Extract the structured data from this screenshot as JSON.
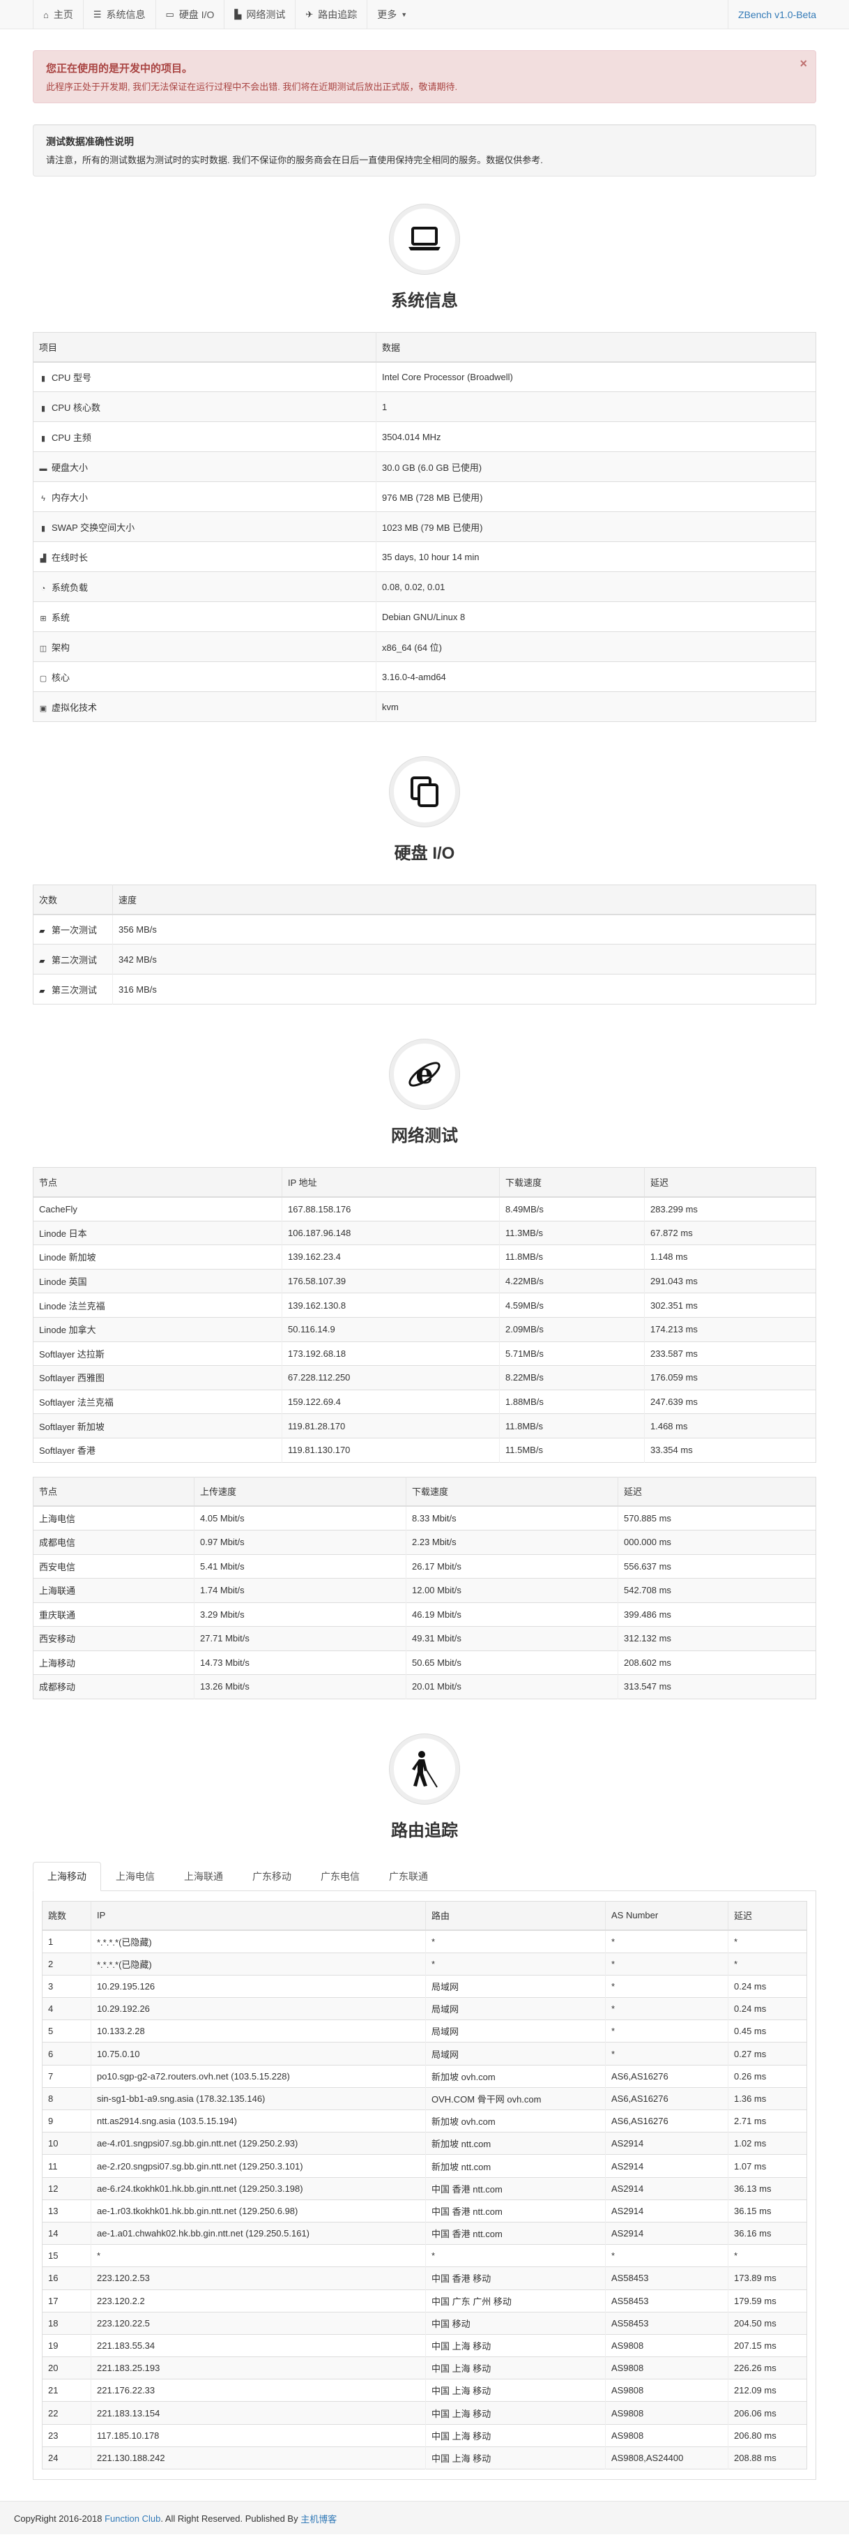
{
  "nav": {
    "items": [
      {
        "icon": "home-icon",
        "glyph": "⌂",
        "label": "主页"
      },
      {
        "icon": "list-icon",
        "glyph": "☰",
        "label": "系统信息"
      },
      {
        "icon": "monitor-icon",
        "glyph": "▭",
        "label": "硬盘 I/O"
      },
      {
        "icon": "stats-icon",
        "glyph": "▙",
        "label": "网络测试"
      },
      {
        "icon": "plane-icon",
        "glyph": "✈",
        "label": "路由追踪"
      }
    ],
    "more_label": "更多",
    "brand": "ZBench v1.0-Beta"
  },
  "alert": {
    "title": "您正在使用的是开发中的项目。",
    "body": "此程序正处于开发期, 我们无法保证在运行过程中不会出错. 我们将在近期测试后放出正式版，敬请期待.",
    "close": "×"
  },
  "notice": {
    "title": "测试数据准确性说明",
    "body": "请注意，所有的测试数据为测试时的实时数据. 我们不保证你的服务商会在日后一直使用保持完全相同的服务。数据仅供参考."
  },
  "sysinfo": {
    "title": "系统信息",
    "headers": [
      "项目",
      "数据"
    ],
    "rows": [
      {
        "icon": "cpu-icon",
        "glyph": "▮",
        "label": "CPU 型号",
        "value": "Intel Core Processor (Broadwell)"
      },
      {
        "icon": "cpu-icon",
        "glyph": "▮",
        "label": "CPU 核心数",
        "value": "1"
      },
      {
        "icon": "cpu-icon",
        "glyph": "▮",
        "label": "CPU 主频",
        "value": "3504.014 MHz"
      },
      {
        "icon": "hdd-icon",
        "glyph": "▬",
        "label": "硬盘大小",
        "value": "30.0 GB (6.0 GB 已使用)"
      },
      {
        "icon": "flash-icon",
        "glyph": "ϟ",
        "label": "内存大小",
        "value": "976 MB (728 MB 已使用)"
      },
      {
        "icon": "cpu-icon",
        "glyph": "▮",
        "label": "SWAP 交换空间大小",
        "value": "1023 MB (79 MB 已使用)"
      },
      {
        "icon": "chart-icon",
        "glyph": "▟",
        "label": "在线时长",
        "value": "35 days, 10 hour 14 min"
      },
      {
        "icon": "pie-icon",
        "glyph": "◔",
        "label": "系统负载",
        "value": "0.08, 0.02, 0.01"
      },
      {
        "icon": "windows-icon",
        "glyph": "⊞",
        "label": "系统",
        "value": "Debian GNU/Linux 8"
      },
      {
        "icon": "layout-icon",
        "glyph": "◫",
        "label": "架构",
        "value": "x86_64 (64 位)"
      },
      {
        "icon": "code-icon",
        "glyph": "▢",
        "label": "核心",
        "value": "3.16.0-4-amd64"
      },
      {
        "icon": "image-icon",
        "glyph": "▣",
        "label": "虚拟化技术",
        "value": "kvm"
      }
    ]
  },
  "io": {
    "title": "硬盘 I/O",
    "headers": [
      "次数",
      "速度"
    ],
    "rows": [
      {
        "label": "第一次测试",
        "value": "356 MB/s"
      },
      {
        "label": "第二次测试",
        "value": "342 MB/s"
      },
      {
        "label": "第三次测试",
        "value": "316 MB/s"
      }
    ]
  },
  "network": {
    "title": "网络测试",
    "intl_headers": [
      "节点",
      "IP 地址",
      "下载速度",
      "延迟"
    ],
    "intl_rows": [
      [
        "CacheFly",
        "167.88.158.176",
        "8.49MB/s",
        "283.299 ms"
      ],
      [
        "Linode 日本",
        "106.187.96.148",
        "11.3MB/s",
        "67.872 ms"
      ],
      [
        "Linode 新加坡",
        "139.162.23.4",
        "11.8MB/s",
        "1.148 ms"
      ],
      [
        "Linode 英国",
        "176.58.107.39",
        "4.22MB/s",
        "291.043 ms"
      ],
      [
        "Linode 法兰克福",
        "139.162.130.8",
        "4.59MB/s",
        "302.351 ms"
      ],
      [
        "Linode 加拿大",
        "50.116.14.9",
        "2.09MB/s",
        "174.213 ms"
      ],
      [
        "Softlayer 达拉斯",
        "173.192.68.18",
        "5.71MB/s",
        "233.587 ms"
      ],
      [
        "Softlayer 西雅图",
        "67.228.112.250",
        "8.22MB/s",
        "176.059 ms"
      ],
      [
        "Softlayer 法兰克福",
        "159.122.69.4",
        "1.88MB/s",
        "247.639 ms"
      ],
      [
        "Softlayer 新加坡",
        "119.81.28.170",
        "11.8MB/s",
        "1.468 ms"
      ],
      [
        "Softlayer 香港",
        "119.81.130.170",
        "11.5MB/s",
        "33.354 ms"
      ]
    ],
    "cn_headers": [
      "节点",
      "上传速度",
      "下载速度",
      "延迟"
    ],
    "cn_rows": [
      [
        "上海电信",
        "4.05 Mbit/s",
        "8.33 Mbit/s",
        "570.885 ms"
      ],
      [
        "成都电信",
        "0.97 Mbit/s",
        "2.23 Mbit/s",
        "000.000 ms"
      ],
      [
        "西安电信",
        "5.41 Mbit/s",
        "26.17 Mbit/s",
        "556.637 ms"
      ],
      [
        "上海联通",
        "1.74 Mbit/s",
        "12.00 Mbit/s",
        "542.708 ms"
      ],
      [
        "重庆联通",
        "3.29 Mbit/s",
        "46.19 Mbit/s",
        "399.486 ms"
      ],
      [
        "西安移动",
        "27.71 Mbit/s",
        "49.31 Mbit/s",
        "312.132 ms"
      ],
      [
        "上海移动",
        "14.73 Mbit/s",
        "50.65 Mbit/s",
        "208.602 ms"
      ],
      [
        "成都移动",
        "13.26 Mbit/s",
        "20.01 Mbit/s",
        "313.547 ms"
      ]
    ]
  },
  "route": {
    "title": "路由追踪",
    "tabs": [
      "上海移动",
      "上海电信",
      "上海联通",
      "广东移动",
      "广东电信",
      "广东联通"
    ],
    "headers": [
      "跳数",
      "IP",
      "路由",
      "AS Number",
      "延迟"
    ],
    "rows": [
      [
        "1",
        "*.*.*.*(已隐藏)",
        "*",
        "*",
        "*"
      ],
      [
        "2",
        "*.*.*.*(已隐藏)",
        "*",
        "*",
        "*"
      ],
      [
        "3",
        "10.29.195.126",
        "局域网",
        "*",
        "0.24 ms"
      ],
      [
        "4",
        "10.29.192.26",
        "局域网",
        "*",
        "0.24 ms"
      ],
      [
        "5",
        "10.133.2.28",
        "局域网",
        "*",
        "0.45 ms"
      ],
      [
        "6",
        "10.75.0.10",
        "局域网",
        "*",
        "0.27 ms"
      ],
      [
        "7",
        "po10.sgp-g2-a72.routers.ovh.net (103.5.15.228)",
        "新加坡 ovh.com",
        "AS6,AS16276",
        "0.26 ms"
      ],
      [
        "8",
        "sin-sg1-bb1-a9.sng.asia (178.32.135.146)",
        "OVH.COM 骨干网 ovh.com",
        "AS6,AS16276",
        "1.36 ms"
      ],
      [
        "9",
        "ntt.as2914.sng.asia (103.5.15.194)",
        "新加坡 ovh.com",
        "AS6,AS16276",
        "2.71 ms"
      ],
      [
        "10",
        "ae-4.r01.sngpsi07.sg.bb.gin.ntt.net (129.250.2.93)",
        "新加坡 ntt.com",
        "AS2914",
        "1.02 ms"
      ],
      [
        "11",
        "ae-2.r20.sngpsi07.sg.bb.gin.ntt.net (129.250.3.101)",
        "新加坡 ntt.com",
        "AS2914",
        "1.07 ms"
      ],
      [
        "12",
        "ae-6.r24.tkokhk01.hk.bb.gin.ntt.net (129.250.3.198)",
        "中国 香港 ntt.com",
        "AS2914",
        "36.13 ms"
      ],
      [
        "13",
        "ae-1.r03.tkokhk01.hk.bb.gin.ntt.net (129.250.6.98)",
        "中国 香港 ntt.com",
        "AS2914",
        "36.15 ms"
      ],
      [
        "14",
        "ae-1.a01.chwahk02.hk.bb.gin.ntt.net (129.250.5.161)",
        "中国 香港 ntt.com",
        "AS2914",
        "36.16 ms"
      ],
      [
        "15",
        "*",
        "*",
        "*",
        "*"
      ],
      [
        "16",
        "223.120.2.53",
        "中国 香港 移动",
        "AS58453",
        "173.89 ms"
      ],
      [
        "17",
        "223.120.2.2",
        "中国 广东 广州 移动",
        "AS58453",
        "179.59 ms"
      ],
      [
        "18",
        "223.120.22.5",
        "中国 移动",
        "AS58453",
        "204.50 ms"
      ],
      [
        "19",
        "221.183.55.34",
        "中国 上海 移动",
        "AS9808",
        "207.15 ms"
      ],
      [
        "20",
        "221.183.25.193",
        "中国 上海 移动",
        "AS9808",
        "226.26 ms"
      ],
      [
        "21",
        "221.176.22.33",
        "中国 上海 移动",
        "AS9808",
        "212.09 ms"
      ],
      [
        "22",
        "221.183.13.154",
        "中国 上海 移动",
        "AS9808",
        "206.06 ms"
      ],
      [
        "23",
        "117.185.10.178",
        "中国 上海 移动",
        "AS9808",
        "206.80 ms"
      ],
      [
        "24",
        "221.130.188.242",
        "中国 上海 移动",
        "AS9808,AS24400",
        "208.88 ms"
      ]
    ]
  },
  "footer": {
    "prefix": "CopyRight 2016-2018 ",
    "link1": "Function Club",
    "middle": ". All Right Reserved. Published By ",
    "link2": "主机博客"
  }
}
